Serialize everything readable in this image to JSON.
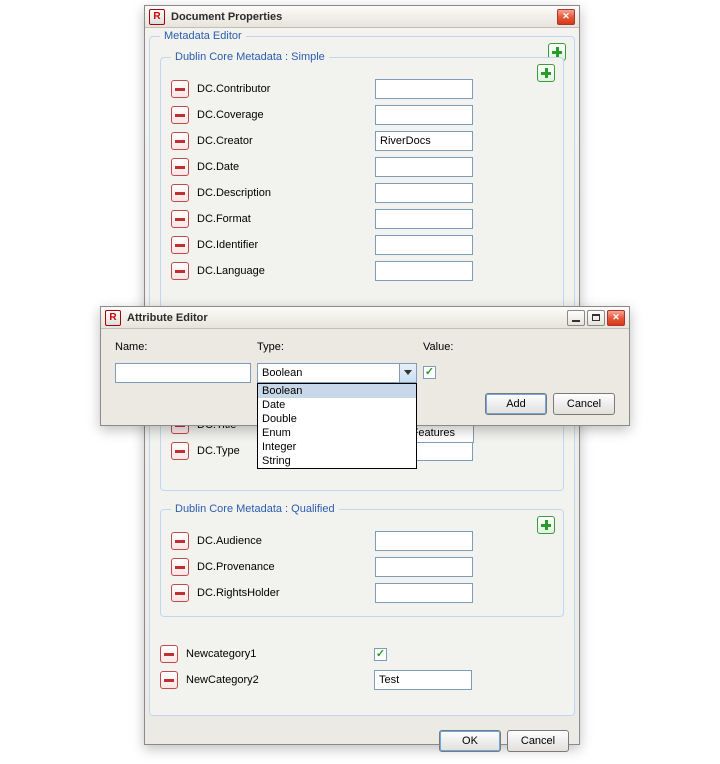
{
  "doc_window": {
    "title": "Document Properties",
    "icon_letter": "R"
  },
  "metadata_editor": {
    "title": "Metadata Editor"
  },
  "dc_simple": {
    "title": "Dublin Core Metadata : Simple",
    "rows": [
      {
        "label": "DC.Contributor",
        "value": ""
      },
      {
        "label": "DC.Coverage",
        "value": ""
      },
      {
        "label": "DC.Creator",
        "value": "RiverDocs"
      },
      {
        "label": "DC.Date",
        "value": ""
      },
      {
        "label": "DC.Description",
        "value": ""
      },
      {
        "label": "DC.Format",
        "value": ""
      },
      {
        "label": "DC.Identifier",
        "value": ""
      },
      {
        "label": "DC.Language",
        "value": ""
      },
      {
        "label": "DC.Title",
        "value_overlay": "tadata Features"
      },
      {
        "label": "DC.Type",
        "value": ""
      }
    ]
  },
  "dc_qualified": {
    "title": "Dublin Core Metadata : Qualified",
    "rows": [
      {
        "label": "DC.Audience",
        "value": ""
      },
      {
        "label": "DC.Provenance",
        "value": ""
      },
      {
        "label": "DC.RightsHolder",
        "value": ""
      }
    ]
  },
  "custom": [
    {
      "label": "Newcategory1",
      "kind": "checkbox",
      "checked": true
    },
    {
      "label": "NewCategory2",
      "kind": "text",
      "value": "Test"
    }
  ],
  "doc_buttons": {
    "ok": "OK",
    "cancel": "Cancel"
  },
  "attr_window": {
    "title": "Attribute Editor",
    "icon_letter": "R",
    "name_label": "Name:",
    "type_label": "Type:",
    "value_label": "Value:",
    "name_value": "",
    "type_selected": "Boolean",
    "type_options": [
      "Boolean",
      "Date",
      "Double",
      "Enum",
      "Integer",
      "String"
    ],
    "value_checked": true,
    "add": "Add",
    "cancel": "Cancel"
  }
}
